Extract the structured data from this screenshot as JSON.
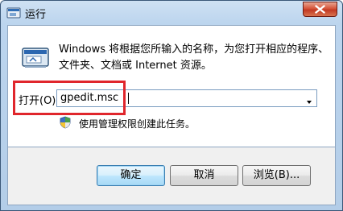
{
  "window": {
    "title": "运行",
    "icon": "run-icon"
  },
  "titlebar": {
    "close_icon": "close-icon"
  },
  "description": {
    "line1": "Windows 将根据您所输入的名称，为您打开相应的程序、",
    "line2": "文件夹、文档或 Internet 资源。"
  },
  "open_field": {
    "label": "打开(O):",
    "value": "gpedit.msc",
    "dropdown_icon": "chevron-down-icon"
  },
  "admin_note": {
    "icon": "shield-icon",
    "text": "使用管理权限创建此任务。"
  },
  "buttons": {
    "ok": "确定",
    "cancel": "取消",
    "browse": "浏览(B)..."
  },
  "colors": {
    "highlight": "#e0262c",
    "default_button_border": "#3c7fb1"
  }
}
